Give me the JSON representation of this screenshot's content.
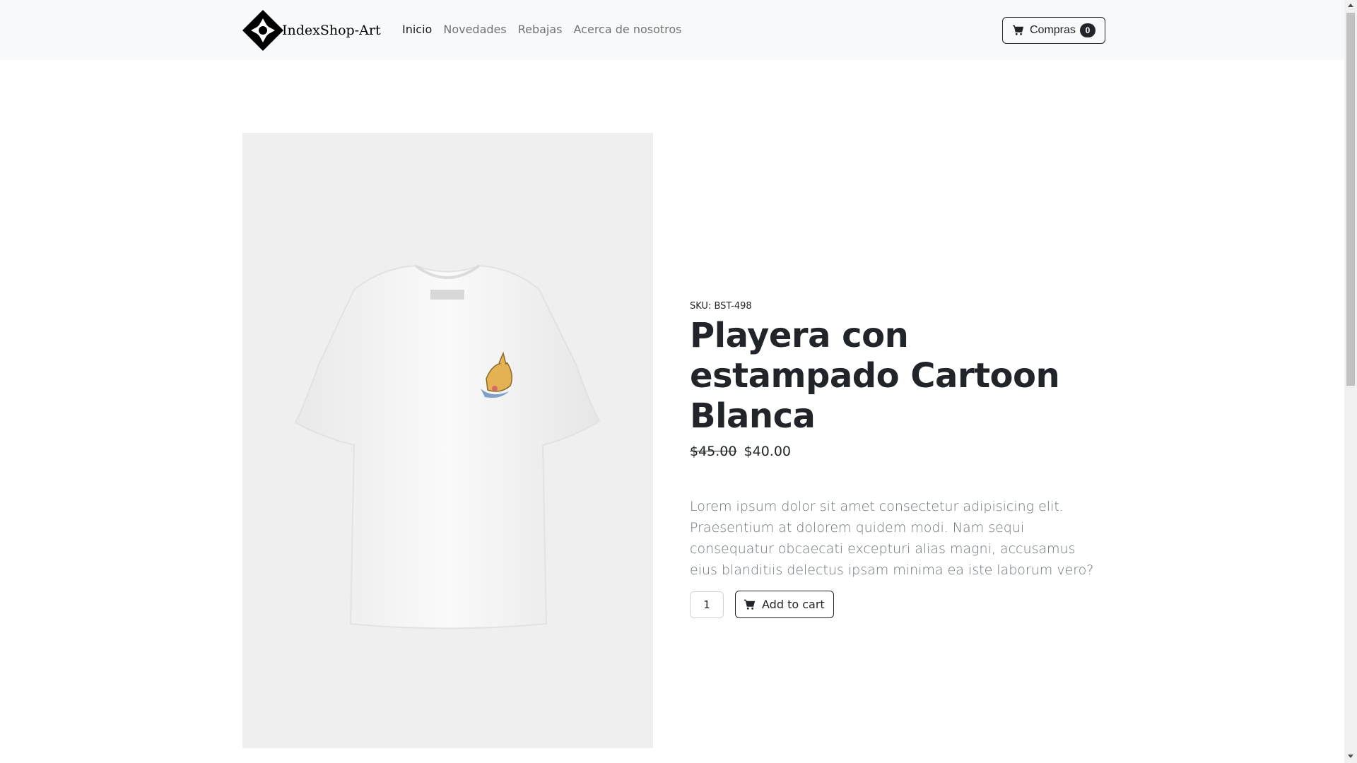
{
  "navbar": {
    "brand_name": "IndexShop-Art",
    "brand_icon": "diamond-logo-icon",
    "links": [
      {
        "label": "Inicio",
        "active": true
      },
      {
        "label": "Novedades",
        "active": false
      },
      {
        "label": "Rebajas",
        "active": false
      },
      {
        "label": "Acerca de nosotros",
        "active": false
      }
    ],
    "cart": {
      "icon": "cart-icon",
      "label": "Compras",
      "count": "0"
    }
  },
  "product": {
    "image_alt": "white-tshirt-cartoon-print",
    "sku": "SKU: BST-498",
    "title": "Playera con estampado Cartoon Blanca",
    "old_price": "$45.00",
    "price": "$40.00",
    "description": "Lorem ipsum dolor sit amet consectetur adipisicing elit. Praesentium at dolorem quidem modi. Nam sequi consequatur obcaecati excepturi alias magni, accusamus eius blanditiis delectus ipsam minima ea iste laborum vero?",
    "quantity": "1",
    "add_to_cart_label": "Add to cart"
  },
  "colors": {
    "navbar_bg": "#f8f9fa",
    "text_dark": "#212529",
    "text_muted": "#6c757d",
    "image_bg": "#efefef"
  }
}
